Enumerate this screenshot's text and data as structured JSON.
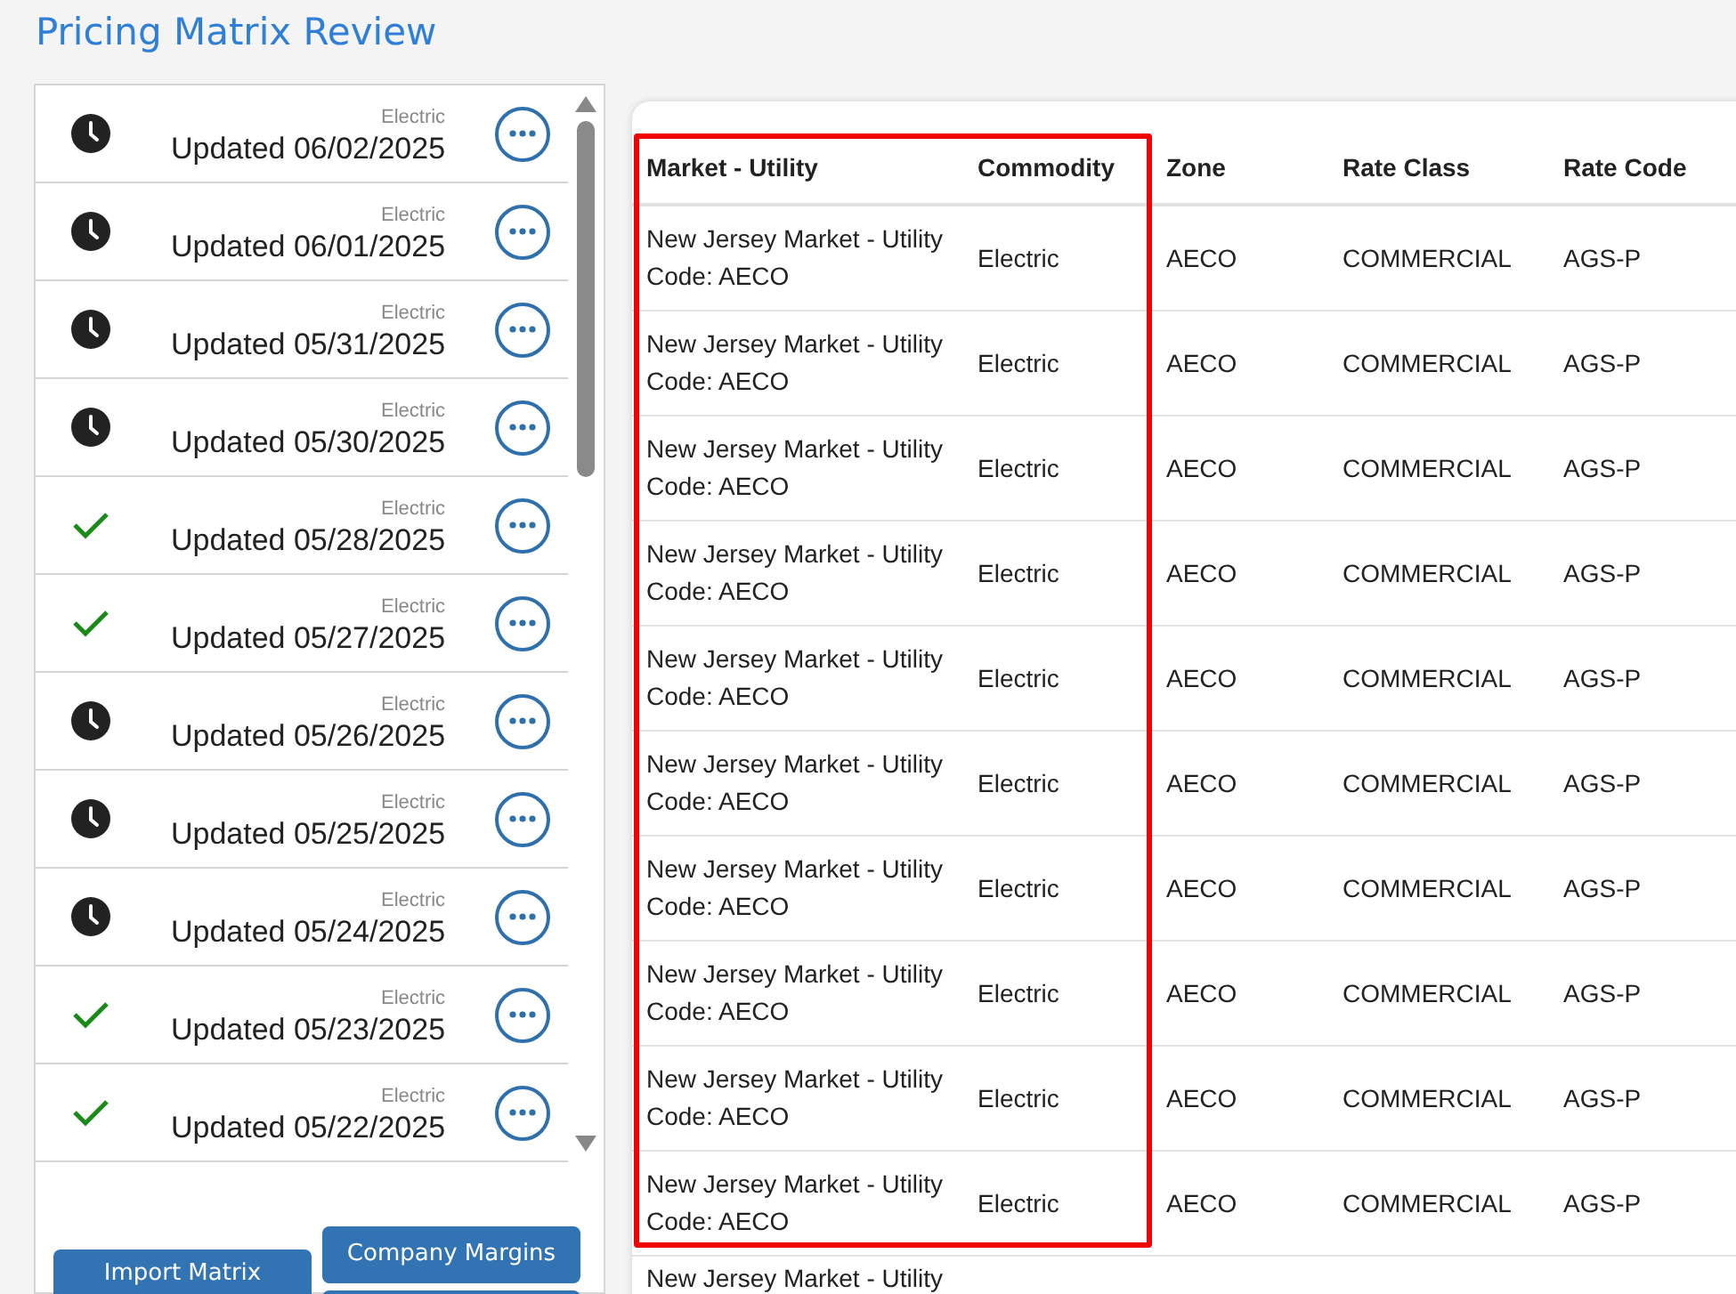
{
  "title": "Pricing Matrix Review",
  "matrices": [
    {
      "commodity": "Electric",
      "label": "Updated 06/02/2025",
      "kind": "pending"
    },
    {
      "commodity": "Electric",
      "label": "Updated 06/01/2025",
      "kind": "pending"
    },
    {
      "commodity": "Electric",
      "label": "Updated 05/31/2025",
      "kind": "pending"
    },
    {
      "commodity": "Electric",
      "label": "Updated 05/30/2025",
      "kind": "pending"
    },
    {
      "commodity": "Electric",
      "label": "Updated 05/28/2025",
      "kind": "approved"
    },
    {
      "commodity": "Electric",
      "label": "Updated 05/27/2025",
      "kind": "approved"
    },
    {
      "commodity": "Electric",
      "label": "Updated 05/26/2025",
      "kind": "pending"
    },
    {
      "commodity": "Electric",
      "label": "Updated 05/25/2025",
      "kind": "pending"
    },
    {
      "commodity": "Electric",
      "label": "Updated 05/24/2025",
      "kind": "pending"
    },
    {
      "commodity": "Electric",
      "label": "Updated 05/23/2025",
      "kind": "approved"
    },
    {
      "commodity": "Electric",
      "label": "Updated 05/22/2025",
      "kind": "approved"
    }
  ],
  "buttons": {
    "import": "Import Matrix",
    "margins": "Company Margins"
  },
  "table": {
    "columns": [
      "Market - Utility",
      "Commodity",
      "Zone",
      "Rate Class",
      "Rate Code"
    ],
    "rows": [
      [
        "New Jersey Market - Utility Code: AECO",
        "Electric",
        "AECO",
        "COMMERCIAL",
        "AGS-P"
      ],
      [
        "New Jersey Market - Utility Code: AECO",
        "Electric",
        "AECO",
        "COMMERCIAL",
        "AGS-P"
      ],
      [
        "New Jersey Market - Utility Code: AECO",
        "Electric",
        "AECO",
        "COMMERCIAL",
        "AGS-P"
      ],
      [
        "New Jersey Market - Utility Code: AECO",
        "Electric",
        "AECO",
        "COMMERCIAL",
        "AGS-P"
      ],
      [
        "New Jersey Market - Utility Code: AECO",
        "Electric",
        "AECO",
        "COMMERCIAL",
        "AGS-P"
      ],
      [
        "New Jersey Market - Utility Code: AECO",
        "Electric",
        "AECO",
        "COMMERCIAL",
        "AGS-P"
      ],
      [
        "New Jersey Market - Utility Code: AECO",
        "Electric",
        "AECO",
        "COMMERCIAL",
        "AGS-P"
      ],
      [
        "New Jersey Market - Utility Code: AECO",
        "Electric",
        "AECO",
        "COMMERCIAL",
        "AGS-P"
      ],
      [
        "New Jersey Market - Utility Code: AECO",
        "Electric",
        "AECO",
        "COMMERCIAL",
        "AGS-P"
      ],
      [
        "New Jersey Market - Utility Code: AECO",
        "Electric",
        "AECO",
        "COMMERCIAL",
        "AGS-P"
      ]
    ],
    "partial_row": "New Jersey Market - Utility"
  }
}
